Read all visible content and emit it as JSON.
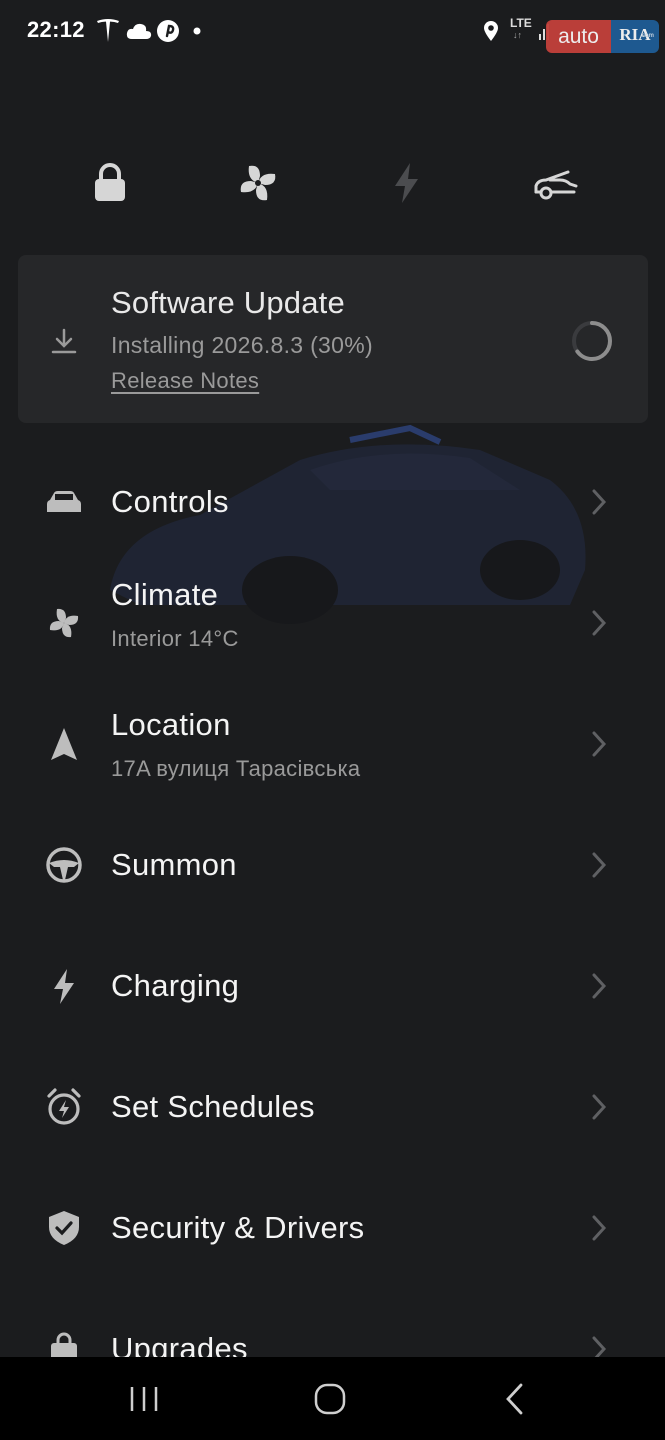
{
  "status_bar": {
    "time": "22:12",
    "network": "LTE",
    "network_arrows": "↓↑",
    "watermark_auto": "auto",
    "watermark_ria": "RIA",
    "watermark_ria_com": ".com"
  },
  "quick_actions": [
    {
      "icon": "lock-icon"
    },
    {
      "icon": "fan-icon"
    },
    {
      "icon": "bolt-icon"
    },
    {
      "icon": "frunk-icon"
    }
  ],
  "software_update": {
    "title": "Software Update",
    "status": "Installing 2026.8.3 (30%)",
    "progress_percent": 30,
    "link": "Release Notes"
  },
  "menu": {
    "controls": {
      "title": "Controls"
    },
    "climate": {
      "title": "Climate",
      "subtitle": "Interior 14°C"
    },
    "location": {
      "title": "Location",
      "subtitle": "17A вулиця Тарасівська"
    },
    "summon": {
      "title": "Summon"
    },
    "charging": {
      "title": "Charging"
    },
    "schedules": {
      "title": "Set Schedules"
    },
    "security": {
      "title": "Security & Drivers"
    },
    "upgrades": {
      "title": "Upgrades"
    }
  },
  "colors": {
    "background": "#1b1c1e",
    "card": "#262729",
    "text": "#f4f4f4",
    "muted": "#9a9a9a"
  }
}
